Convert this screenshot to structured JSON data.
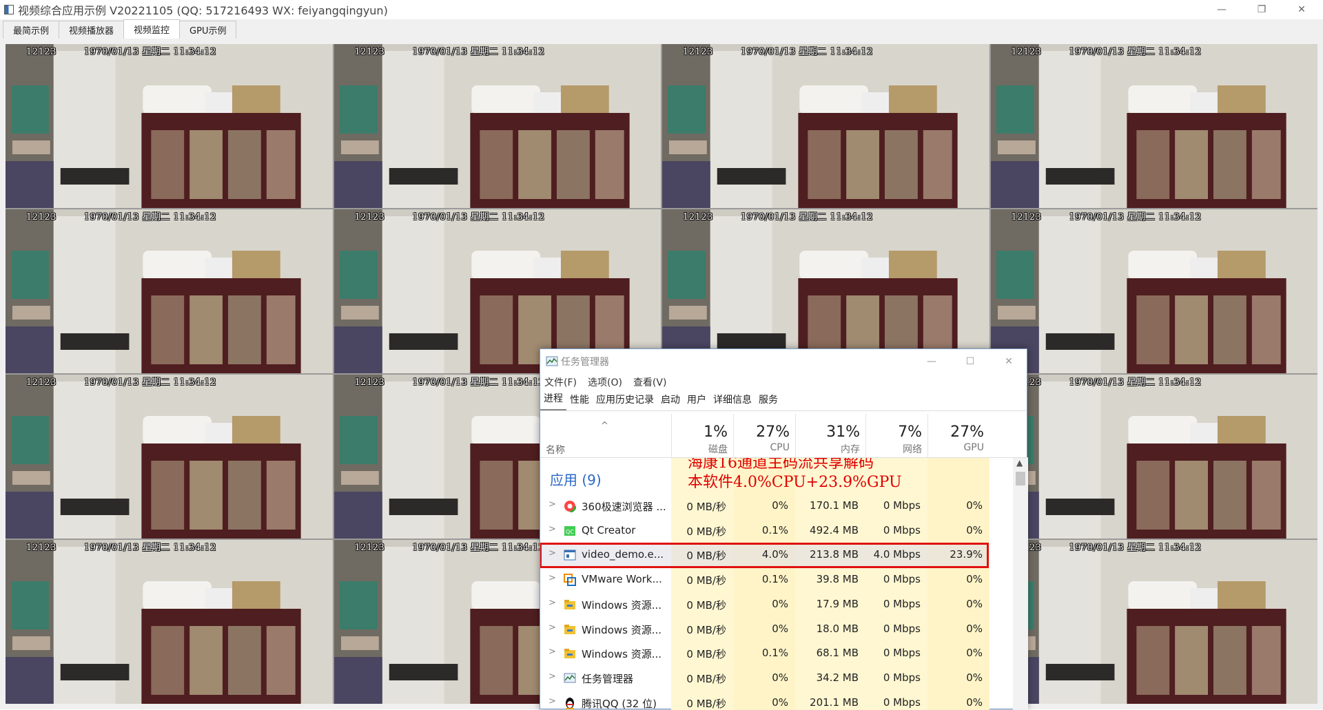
{
  "window": {
    "title": "视频综合应用示例 V20221105 (QQ: 517216493 WX: feiyangqingyun)",
    "controls": {
      "minimize": "—",
      "restore": "❐",
      "close": "✕"
    }
  },
  "tabs": [
    {
      "label": "最简示例",
      "active": false
    },
    {
      "label": "视频播放器",
      "active": false
    },
    {
      "label": "视频监控",
      "active": true
    },
    {
      "label": "GPU示例",
      "active": false
    }
  ],
  "channels": {
    "count": 16,
    "osd_id": "12123",
    "osd_datetime": "1970/01/13 星期二 11:34:12"
  },
  "task_manager": {
    "title": "任务管理器",
    "menu": [
      "文件(F)",
      "选项(O)",
      "查看(V)"
    ],
    "tabs": [
      "进程",
      "性能",
      "应用历史记录",
      "启动",
      "用户",
      "详细信息",
      "服务"
    ],
    "name_header": "名称",
    "sort_arrow": "^",
    "columns": [
      {
        "pct": "1%",
        "label": "磁盘"
      },
      {
        "pct": "27%",
        "label": "CPU"
      },
      {
        "pct": "31%",
        "label": "内存"
      },
      {
        "pct": "7%",
        "label": "网络"
      },
      {
        "pct": "27%",
        "label": "GPU"
      }
    ],
    "group_header": "应用 (9)",
    "annotation_line1": "海康16通道主码流共享解码",
    "annotation_line2": "本软件4.0%CPU+23.9%GPU",
    "processes": [
      {
        "name": "360极速浏览器 ...",
        "icon": "browser-360-icon",
        "disk": "0 MB/秒",
        "cpu": "0%",
        "mem": "170.1 MB",
        "net": "0 Mbps",
        "gpu": "0%"
      },
      {
        "name": "Qt Creator",
        "icon": "qt-creator-icon",
        "disk": "0 MB/秒",
        "cpu": "0.1%",
        "mem": "492.4 MB",
        "net": "0 Mbps",
        "gpu": "0%"
      },
      {
        "name": "video_demo.e...",
        "icon": "app-window-icon",
        "disk": "0 MB/秒",
        "cpu": "4.0%",
        "mem": "213.8 MB",
        "net": "4.0 Mbps",
        "gpu": "23.9%",
        "highlight": true
      },
      {
        "name": "VMware Work...",
        "icon": "vmware-icon",
        "disk": "0 MB/秒",
        "cpu": "0.1%",
        "mem": "39.8 MB",
        "net": "0 Mbps",
        "gpu": "0%"
      },
      {
        "name": "Windows 资源...",
        "icon": "explorer-folder-icon",
        "disk": "0 MB/秒",
        "cpu": "0%",
        "mem": "17.9 MB",
        "net": "0 Mbps",
        "gpu": "0%"
      },
      {
        "name": "Windows 资源...",
        "icon": "explorer-folder-icon",
        "disk": "0 MB/秒",
        "cpu": "0%",
        "mem": "18.0 MB",
        "net": "0 Mbps",
        "gpu": "0%"
      },
      {
        "name": "Windows 资源...",
        "icon": "explorer-folder-icon",
        "disk": "0 MB/秒",
        "cpu": "0.1%",
        "mem": "68.1 MB",
        "net": "0 Mbps",
        "gpu": "0%"
      },
      {
        "name": "任务管理器",
        "icon": "task-manager-icon",
        "disk": "0 MB/秒",
        "cpu": "0%",
        "mem": "34.2 MB",
        "net": "0 Mbps",
        "gpu": "0%"
      },
      {
        "name": "腾讯QQ (32 位)",
        "icon": "qq-penguin-icon",
        "disk": "0 MB/秒",
        "cpu": "0%",
        "mem": "201.1 MB",
        "net": "0 Mbps",
        "gpu": "0%"
      }
    ]
  }
}
